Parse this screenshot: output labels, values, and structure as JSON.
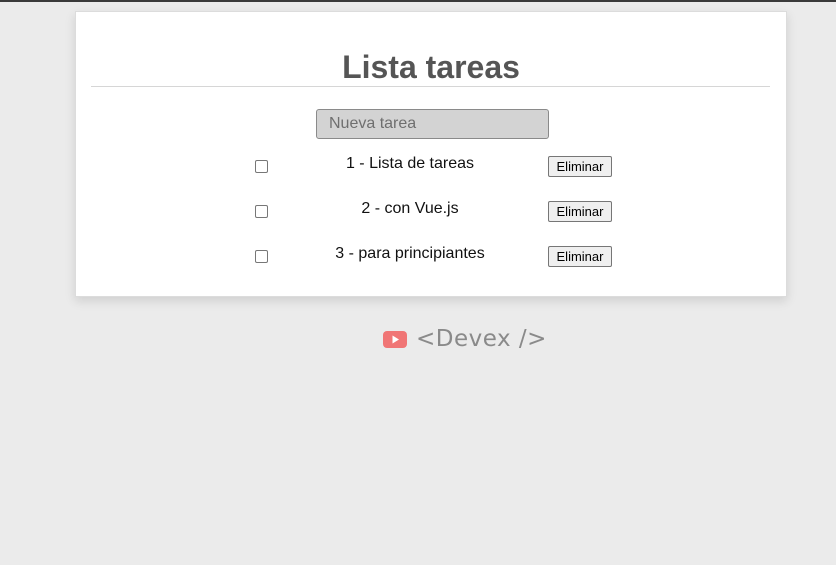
{
  "app": {
    "title": "Lista tareas"
  },
  "input": {
    "placeholder": "Nueva tarea",
    "value": ""
  },
  "tasks": [
    {
      "text": "1 - Lista de tareas",
      "done": false,
      "delete_label": "Eliminar"
    },
    {
      "text": "2 - con Vue.js",
      "done": false,
      "delete_label": "Eliminar"
    },
    {
      "text": "3 - para principiantes",
      "done": false,
      "delete_label": "Eliminar"
    }
  ],
  "footer": {
    "brand": "<Devex />",
    "icon": "youtube-icon",
    "icon_color": "#f07575"
  },
  "colors": {
    "background": "#ebebeb",
    "card": "#ffffff",
    "title": "#555555",
    "input_bg": "#d3d3d3"
  }
}
